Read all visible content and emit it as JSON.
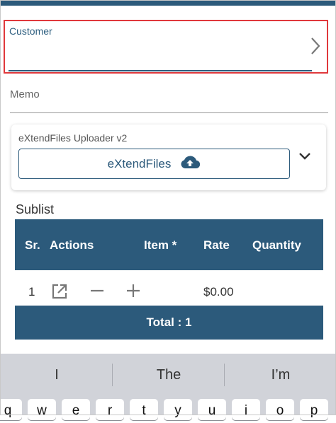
{
  "customer": {
    "label": "Customer",
    "value": ""
  },
  "memo": {
    "label": "Memo",
    "value": ""
  },
  "uploader": {
    "title": "eXtendFiles Uploader v2",
    "button_label": "eXtendFiles"
  },
  "sublist": {
    "title": "Sublist",
    "columns": [
      "Sr.",
      "Actions",
      "Item *",
      "Rate",
      "Quantity"
    ],
    "rows": [
      {
        "sr": "1",
        "item": "",
        "rate": "$0.00",
        "quantity": ""
      }
    ],
    "total_label": "Total : 1"
  },
  "keyboard": {
    "suggestions": [
      "I",
      "The",
      "I’m"
    ],
    "top_row_keys": [
      "q",
      "w",
      "e",
      "r",
      "t",
      "y",
      "u",
      "i",
      "o",
      "p"
    ]
  },
  "colors": {
    "primary": "#2c5a7b",
    "focus_border": "#e0383b"
  }
}
